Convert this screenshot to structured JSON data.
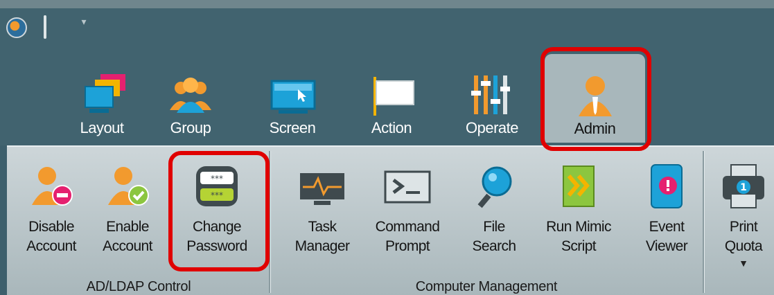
{
  "tabs": [
    {
      "label": "Layout",
      "icon": "layout-icon"
    },
    {
      "label": "Group",
      "icon": "group-icon"
    },
    {
      "label": "Screen",
      "icon": "screen-icon"
    },
    {
      "label": "Action",
      "icon": "action-icon"
    },
    {
      "label": "Operate",
      "icon": "operate-icon"
    },
    {
      "label": "Admin",
      "icon": "admin-icon",
      "active": true
    }
  ],
  "groups": {
    "ad_ldap": {
      "label": "AD/LDAP Control",
      "buttons": [
        {
          "line1": "Disable",
          "line2": "Account"
        },
        {
          "line1": "Enable",
          "line2": "Account"
        },
        {
          "line1": "Change",
          "line2": "Password"
        }
      ]
    },
    "computer_mgmt": {
      "label": "Computer Management",
      "buttons": [
        {
          "line1": "Task",
          "line2": "Manager"
        },
        {
          "line1": "Command",
          "line2": "Prompt"
        },
        {
          "line1": "File",
          "line2": "Search"
        },
        {
          "line1": "Run Mimic",
          "line2": "Script"
        },
        {
          "line1": "Event",
          "line2": "Viewer"
        }
      ]
    },
    "print": {
      "buttons": [
        {
          "line1": "Print",
          "line2": "Quota",
          "badge": "1"
        }
      ]
    }
  },
  "colors": {
    "ribbon_bg": "#41636f",
    "panel_bg": "#cdd6d9",
    "highlight": "#e00000",
    "orange": "#f29a2e"
  }
}
